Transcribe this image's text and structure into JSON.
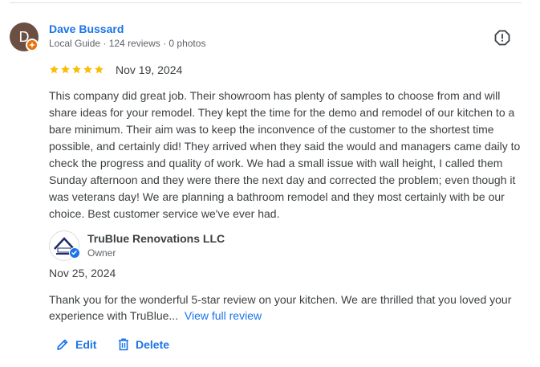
{
  "review": {
    "reviewer_name": "Dave Bussard",
    "avatar_initial": "D",
    "reviewer_meta": "Local Guide · 124 reviews · 0 photos",
    "rating": 5,
    "date": "Nov 19, 2024",
    "text": "This company did great job. Their showroom has plenty of samples to choose from and will share ideas for your remodel. They kept the time for the demo and remodel of our kitchen to a bare minimum. Their aim was to keep the inconvence of the customer to the shortest time possible, and certainly did! They arrived when they said the would and managers came daily to check the progress and quality of work. We had a small issue with wall height, I called them Sunday afternoon and they were there the next day and corrected the problem; even though it was veterans day! We are planning a bathroom remodel and they most certainly with be our choice. Best customer service we've ever had."
  },
  "owner_response": {
    "name": "TruBlue Renovations LLC",
    "role": "Owner",
    "date": "Nov 25, 2024",
    "text": "Thank you for the wonderful 5-star review on your kitchen. We are thrilled that you loved your experience with TruBlue...",
    "link_label": "View full review"
  },
  "actions": {
    "edit_label": "Edit",
    "delete_label": "Delete"
  },
  "colors": {
    "accent": "#1a73e8",
    "star": "#fbbc04",
    "avatar_bg": "#6b4f42",
    "local_guide_badge": "#e8710a"
  },
  "icons": [
    "report-icon",
    "star-icon",
    "pencil-icon",
    "trash-icon",
    "verified-check-icon",
    "local-guide-badge-icon"
  ]
}
